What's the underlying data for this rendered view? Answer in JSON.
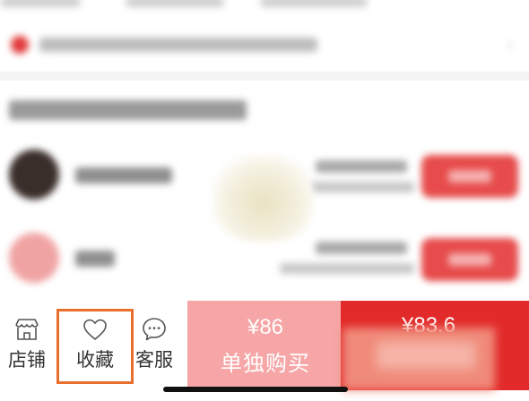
{
  "bottom_bar": {
    "shop": {
      "label": "店铺",
      "icon": "store-icon"
    },
    "favorite": {
      "label": "收藏",
      "icon": "heart-icon"
    },
    "service": {
      "label": "客服",
      "icon": "chat-icon"
    },
    "buy_single": {
      "price": "¥86",
      "label": "单独购买"
    },
    "buy_group": {
      "price": "¥83.6"
    }
  },
  "colors": {
    "accent_red": "#e22a2a",
    "light_red": "#f6a6a6",
    "highlight_orange": "#ea6e2c"
  }
}
